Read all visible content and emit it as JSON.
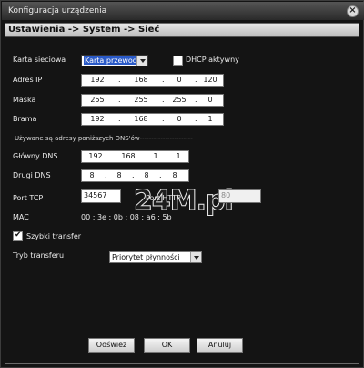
{
  "window": {
    "title": "Konfiguracja urządzenia"
  },
  "header": {
    "breadcrumb": "Ustawienia -> System -> Sieć"
  },
  "network": {
    "card_label": "Karta sieciowa",
    "card_value": "Karta przewodo",
    "dhcp_label": "DHCP aktywny",
    "dhcp_checked": false,
    "ip": {
      "label": "Adres IP",
      "octets": [
        "192",
        "168",
        "0",
        "120"
      ]
    },
    "mask": {
      "label": "Maska",
      "octets": [
        "255",
        "255",
        "255",
        "0"
      ]
    },
    "gateway": {
      "label": "Brama",
      "octets": [
        "192",
        "168",
        "0",
        "1"
      ]
    },
    "dns_separator": "Używane są adresy poniższych DNS'ów-----------------------",
    "dns1": {
      "label": "Główny DNS",
      "octets": [
        "192",
        "168",
        "1",
        "1"
      ]
    },
    "dns2": {
      "label": "Drugi DNS",
      "octets": [
        "8",
        "8",
        "8",
        "8"
      ]
    },
    "tcp_label": "Port TCP",
    "tcp_value": "34567",
    "http_label": "Port HTTP",
    "http_value": "80",
    "mac_label": "MAC",
    "mac_value": "00 : 3e : 0b : 08 : a6 : 5b",
    "fast_transfer_label": "Szybki transfer",
    "fast_transfer_checked": true,
    "transfer_mode_label": "Tryb transferu",
    "transfer_mode_value": "Priorytet płynności"
  },
  "buttons": {
    "refresh": "Odśwież",
    "ok": "OK",
    "cancel": "Anuluj"
  },
  "watermark": "24M.pl"
}
